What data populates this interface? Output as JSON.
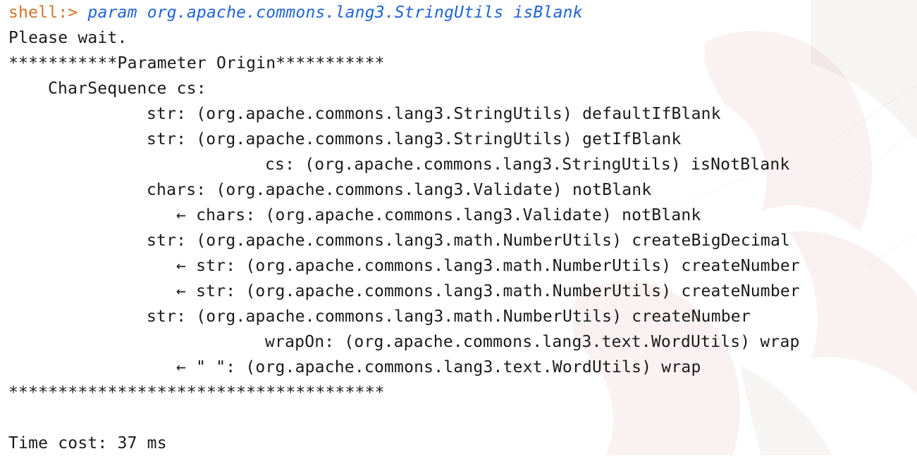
{
  "prompt": {
    "label": "shell:>",
    "command": "param org.apache.commons.lang3.StringUtils isBlank"
  },
  "output": {
    "wait": "Please wait.",
    "header": "***********Parameter Origin***********",
    "param": "CharSequence cs:",
    "entries": [
      "str: (org.apache.commons.lang3.StringUtils) defaultIfBlank",
      "str: (org.apache.commons.lang3.StringUtils) getIfBlank",
      "cs: (org.apache.commons.lang3.StringUtils) isNotBlank",
      "chars: (org.apache.commons.lang3.Validate) notBlank",
      "← chars: (org.apache.commons.lang3.Validate) notBlank",
      "str: (org.apache.commons.lang3.math.NumberUtils) createBigDecimal",
      "← str: (org.apache.commons.lang3.math.NumberUtils) createNumber",
      "← str: (org.apache.commons.lang3.math.NumberUtils) createNumber",
      "str: (org.apache.commons.lang3.math.NumberUtils) createNumber",
      "wrapOn: (org.apache.commons.lang3.text.WordUtils) wrap",
      "← \" \": (org.apache.commons.lang3.text.WordUtils) wrap"
    ],
    "footer": "**************************************",
    "time_cost": "Time cost: 37 ms"
  }
}
